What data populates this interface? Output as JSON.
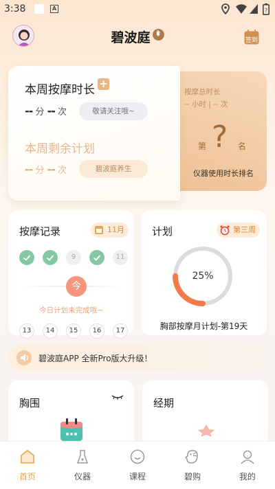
{
  "status_bar": {
    "time": "3:38",
    "letter_icon": "A"
  },
  "header": {
    "title": "碧波庭",
    "signin_label": "签到"
  },
  "weekly": {
    "title": "本周按摩时长",
    "minutes": "--",
    "minutes_unit": "分",
    "count": "--",
    "count_unit": "次",
    "pending_pill": "敬请关注哦~",
    "plan_title": "本周剩余计划",
    "plan_minutes": "--",
    "plan_minutes_unit": "分",
    "plan_count": "--",
    "plan_count_unit": "次",
    "care_pill": "碧波庭养生"
  },
  "rank": {
    "label": "按摩总时长",
    "value_line": "-- 小时 | -- 次",
    "prefix": "第",
    "rank": "?",
    "suffix": "名",
    "caption": "仪器使用时长排名"
  },
  "record": {
    "title": "按摩记录",
    "month_tag": "11月",
    "dots": [
      {
        "label": "",
        "done": true
      },
      {
        "label": "",
        "done": true
      },
      {
        "label": "9",
        "done": false
      },
      {
        "label": "",
        "done": true
      },
      {
        "label": "11",
        "done": false
      }
    ],
    "today_label": "今",
    "today_note": "今日计划未完成哦~",
    "days": [
      "13",
      "14",
      "15",
      "16",
      "17"
    ]
  },
  "plan": {
    "title": "计划",
    "week_tag": "第三周",
    "progress": 25,
    "progress_text": "25%",
    "caption": "胸部按摩月计划-第19天"
  },
  "banner": {
    "text": "碧波庭APP 全新Pro版大升级！"
  },
  "bottom_cards": {
    "bust": "胸围",
    "period": "经期"
  },
  "tabs": [
    {
      "label": "首页",
      "icon": "home-icon",
      "active": true
    },
    {
      "label": "仪器",
      "icon": "device-icon",
      "active": false
    },
    {
      "label": "课程",
      "icon": "course-icon",
      "active": false
    },
    {
      "label": "碧购",
      "icon": "shop-icon",
      "active": false
    },
    {
      "label": "我的",
      "icon": "profile-icon",
      "active": false
    }
  ],
  "colors": {
    "accent": "#e7a44b",
    "progress": "#f17b4a",
    "done_dot": "#84c9a4",
    "today": "#f7967d"
  }
}
